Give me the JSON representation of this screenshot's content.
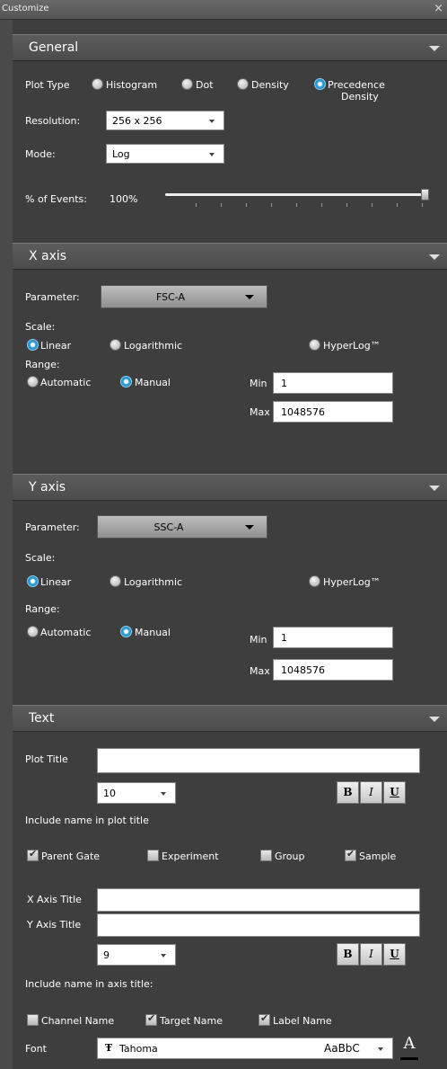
{
  "window": {
    "title": "Customize",
    "close_glyph": "×"
  },
  "general": {
    "header": "General",
    "plot_type_label": "Plot Type",
    "plot_types": [
      {
        "label": "Histogram",
        "selected": false
      },
      {
        "label": "Dot",
        "selected": false
      },
      {
        "label": "Density",
        "selected": false
      },
      {
        "label": "Precedence",
        "label2": "Density",
        "selected": true
      }
    ],
    "resolution_label": "Resolution:",
    "resolution_value": "256 x 256",
    "mode_label": "Mode:",
    "mode_value": "Log",
    "events_label": "% of Events:",
    "events_value": "100%",
    "events_fraction": 1.0
  },
  "xaxis": {
    "header": "X axis",
    "parameter_label": "Parameter:",
    "parameter_value": "FSC-A",
    "scale_label": "Scale:",
    "scale_options": [
      {
        "label": "Linear",
        "selected": true
      },
      {
        "label": "Logarithmic",
        "selected": false
      },
      {
        "label": "HyperLog™",
        "selected": false
      }
    ],
    "range_label": "Range:",
    "range_options": [
      {
        "label": "Automatic",
        "selected": false
      },
      {
        "label": "Manual",
        "selected": true
      }
    ],
    "min_label": "Min",
    "min_value": "1",
    "max_label": "Max",
    "max_value": "1048576"
  },
  "yaxis": {
    "header": "Y axis",
    "parameter_label": "Parameter:",
    "parameter_value": "SSC-A",
    "scale_label": "Scale:",
    "scale_options": [
      {
        "label": "Linear",
        "selected": true
      },
      {
        "label": "Logarithmic",
        "selected": false
      },
      {
        "label": "HyperLog™",
        "selected": false
      }
    ],
    "range_label": "Range:",
    "range_options": [
      {
        "label": "Automatic",
        "selected": false
      },
      {
        "label": "Manual",
        "selected": true
      }
    ],
    "min_label": "Min",
    "min_value": "1",
    "max_label": "Max",
    "max_value": "1048576"
  },
  "text": {
    "header": "Text",
    "plot_title_label": "Plot Title",
    "plot_title_value": "",
    "plot_title_size": "10",
    "include_plot_label": "Include name in plot title",
    "plot_checks": [
      {
        "label": "Parent Gate",
        "checked": true
      },
      {
        "label": "Experiment",
        "checked": false
      },
      {
        "label": "Group",
        "checked": false
      },
      {
        "label": "Sample",
        "checked": true
      }
    ],
    "x_axis_title_label": "X Axis Title",
    "x_axis_title_value": "",
    "y_axis_title_label": "Y Axis Title",
    "y_axis_title_value": "",
    "axis_title_size": "9",
    "include_axis_label": "Include name in axis title:",
    "axis_checks": [
      {
        "label": "Channel Name",
        "checked": false
      },
      {
        "label": "Target Name",
        "checked": true
      },
      {
        "label": "Label Name",
        "checked": true
      }
    ],
    "font_label": "Font",
    "font_icon": "Ŧ",
    "font_value": "Tahoma",
    "font_preview": "AaBbC",
    "bold_glyph": "B",
    "italic_glyph": "I",
    "underline_glyph": "U",
    "font_color_glyph": "A"
  }
}
